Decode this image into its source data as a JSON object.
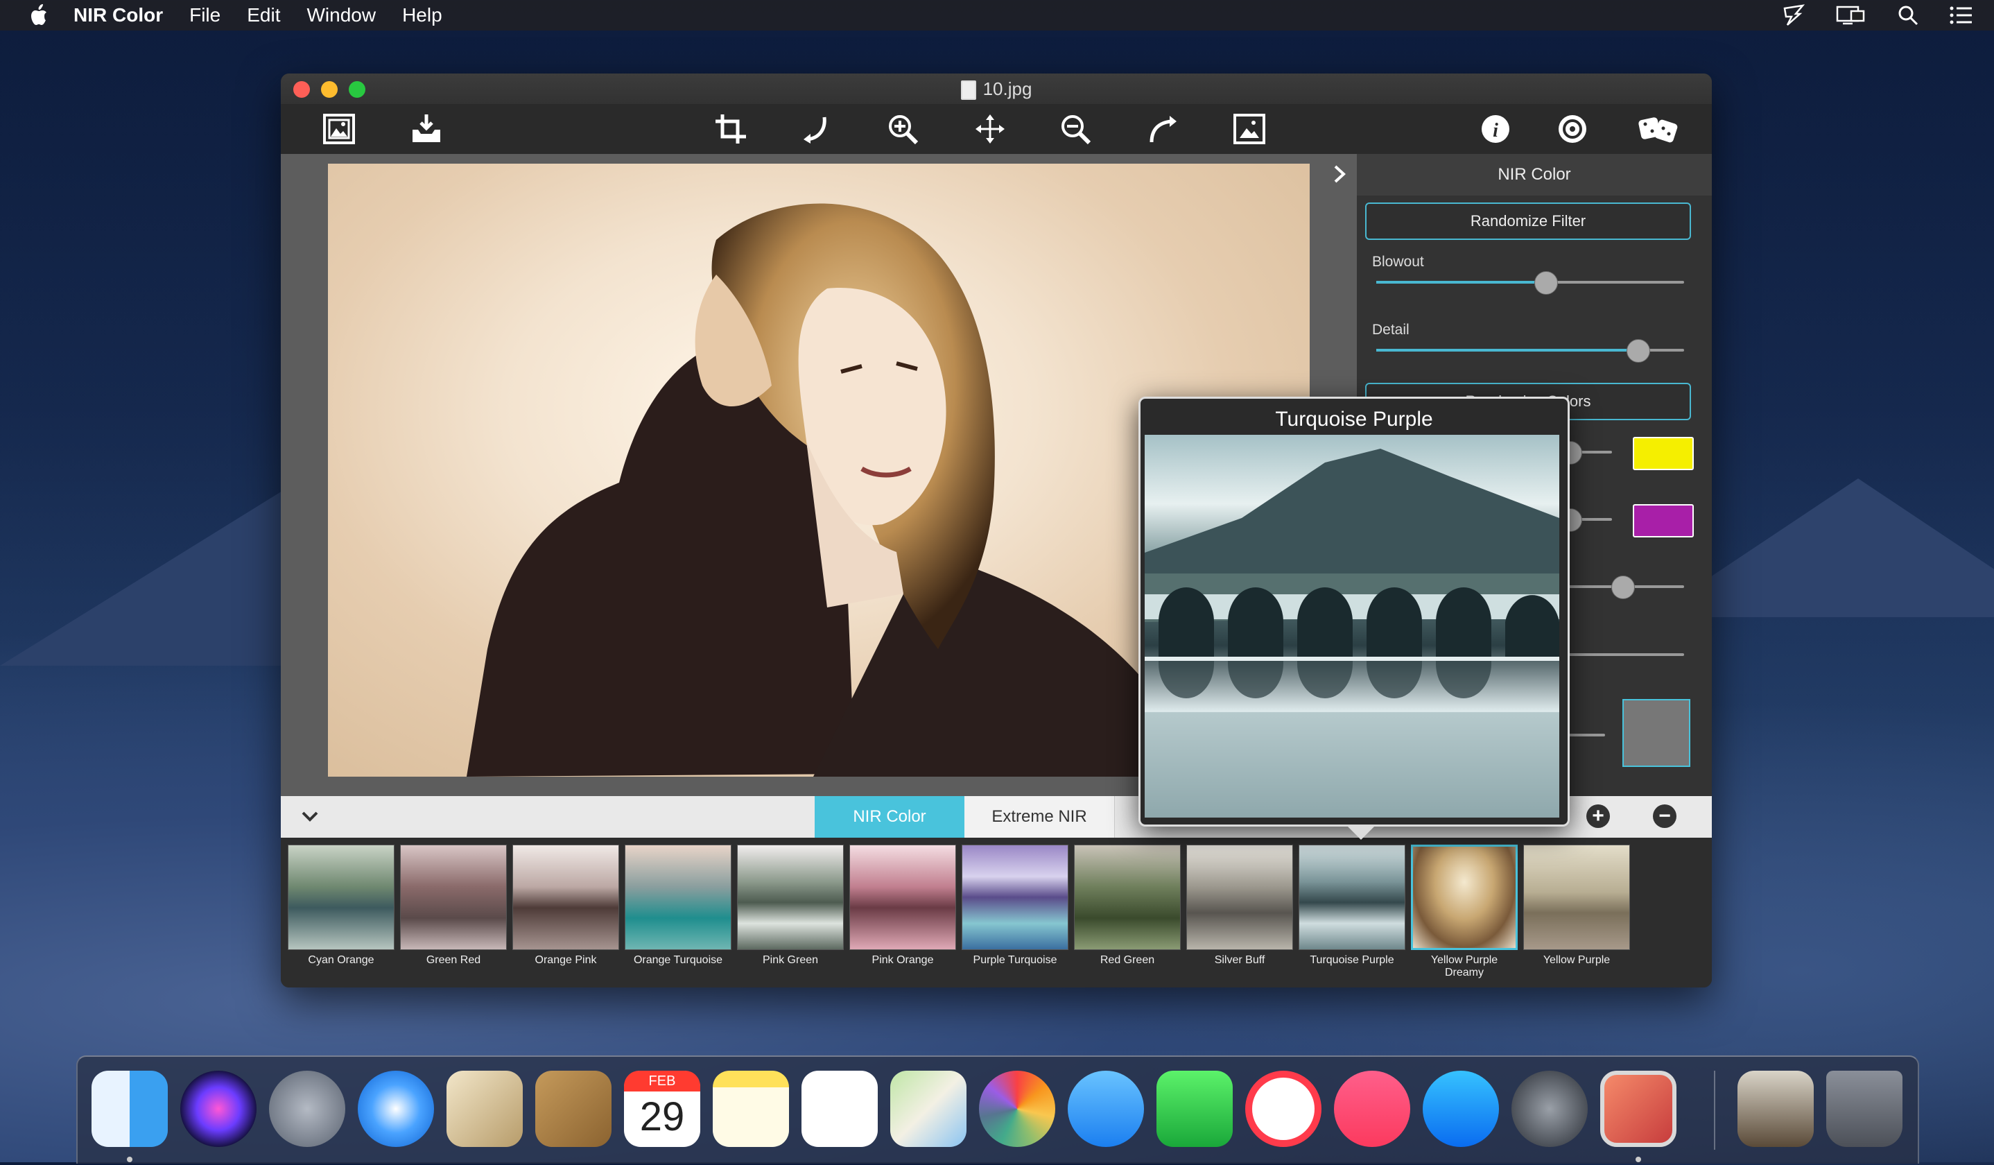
{
  "menubar": {
    "app_name": "NIR Color",
    "items": [
      "File",
      "Edit",
      "Window",
      "Help"
    ],
    "status_icons": [
      "cast-icon",
      "display-icon",
      "spotlight-icon",
      "control-center-icon"
    ]
  },
  "window": {
    "title": "10.jpg",
    "toolbar": {
      "left": [
        "open-image-icon",
        "save-export-icon"
      ],
      "center": [
        "crop-icon",
        "rotate-left-icon",
        "zoom-in-icon",
        "move-icon",
        "zoom-out-icon",
        "rotate-right-icon",
        "fit-image-icon"
      ],
      "right": [
        "info-icon",
        "settings-icon",
        "randomize-dice-icon"
      ]
    }
  },
  "side_panel": {
    "title": "NIR Color",
    "randomize_filter": "Randomize Filter",
    "blowout_label": "Blowout",
    "blowout_value": 0.55,
    "detail_label": "Detail",
    "detail_value": 0.85,
    "randomize_colors": "Randomize Colors",
    "color1": "#f5ef00",
    "color2": "#a81fa8",
    "color1_slider": 0.82,
    "color2_slider": 0.82,
    "slider3": 0.8
  },
  "tabs": {
    "active": "NIR Color",
    "inactive": "Extreme NIR"
  },
  "presets": [
    {
      "label": "Cyan Orange"
    },
    {
      "label": "Green Red"
    },
    {
      "label": "Orange Pink"
    },
    {
      "label": "Orange Turquoise"
    },
    {
      "label": "Pink Green"
    },
    {
      "label": "Pink Orange"
    },
    {
      "label": "Purple Turquoise"
    },
    {
      "label": "Red Green"
    },
    {
      "label": "Silver Buff"
    },
    {
      "label": "Turquoise Purple"
    },
    {
      "label": "Yellow Purple Dreamy"
    },
    {
      "label": "Yellow Purple"
    }
  ],
  "popup": {
    "title": "Turquoise Purple"
  },
  "calendar": {
    "month": "FEB",
    "day": "29"
  },
  "dock_apps": [
    "finder",
    "siri",
    "launchpad",
    "safari",
    "mail",
    "contacts",
    "calendar",
    "notes",
    "reminders",
    "maps",
    "photos",
    "messages",
    "facetime",
    "news",
    "music",
    "app-store",
    "system-preferences",
    "nir-color",
    "downloads",
    "trash"
  ]
}
